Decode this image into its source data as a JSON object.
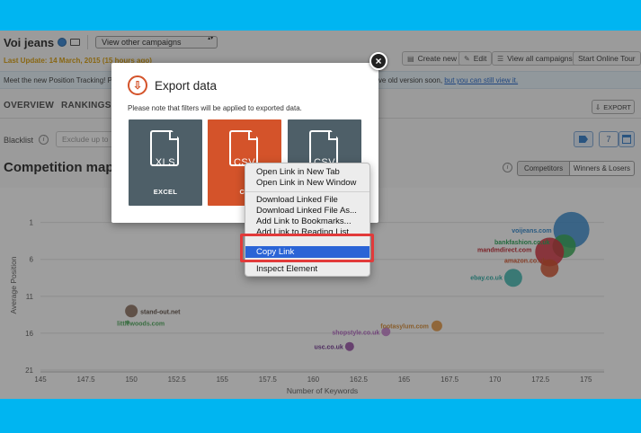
{
  "header": {
    "campaign_title": "Voi jeans",
    "campaign_select": "View other campaigns",
    "last_update": "Last Update: 14 March, 2015 (15 hours ago)"
  },
  "toolbar": {
    "create_new": "Create new",
    "edit": "Edit",
    "view_all": "View all campaigns",
    "start_tour": "Start Online Tour"
  },
  "notice": {
    "left_text": "Meet the new Position Tracking! Pl",
    "right_text": "nove old version soon,",
    "link_text": "but you can still view it."
  },
  "tabs": [
    "OVERVIEW",
    "RANKINGS"
  ],
  "export_button": "EXPORT",
  "blacklist": {
    "label": "Blacklist",
    "placeholder": "Exclude up to"
  },
  "filter_count": "7",
  "competition_map": {
    "title": "Competition map",
    "toggle_competitors": "Competitors",
    "toggle_winners": "Winners & Losers"
  },
  "chart_data": {
    "type": "scatter",
    "xlabel": "Number of Keywords",
    "ylabel": "Average Position",
    "xlim": [
      145,
      176
    ],
    "ylim": [
      21,
      -2
    ],
    "x_ticks": [
      "145",
      "147.5",
      "150",
      "152.5",
      "155",
      "157.5",
      "160",
      "162.5",
      "165",
      "167.5",
      "170",
      "172.5",
      "175"
    ],
    "y_ticks": [
      "1",
      "6",
      "11",
      "16",
      "21"
    ],
    "series": [
      {
        "name": "voijeans.com",
        "x": 174.2,
        "y": 2.0,
        "size": 20,
        "color": "#2a84cc",
        "label_color": "#2a84cc"
      },
      {
        "name": "bankfashion.co.uk",
        "x": 173.8,
        "y": 4.2,
        "size": 13,
        "color": "#2aa84a",
        "label_color": "#22a050"
      },
      {
        "name": "mandmdirect.com",
        "x": 173.0,
        "y": 5.0,
        "size": 16,
        "color": "#d0202e",
        "label_color": "#c0202a"
      },
      {
        "name": "amazon.co.uk",
        "x": 173.0,
        "y": 7.2,
        "size": 10,
        "color": "#d0451e",
        "label_color": "#d04a20"
      },
      {
        "name": "ebay.co.uk",
        "x": 171.0,
        "y": 8.5,
        "size": 10,
        "color": "#2ab0a8",
        "label_color": "#22a8a0"
      },
      {
        "name": "stand-out.net",
        "x": 150.0,
        "y": 13.0,
        "size": 7,
        "color": "#7a5a48",
        "label_color": "#5a4a40"
      },
      {
        "name": "littlewoods.com",
        "x": 149.8,
        "y": 14.5,
        "size": 2,
        "color": "#4aa858",
        "label_color": "#4aa858"
      },
      {
        "name": "footasylum.com",
        "x": 166.8,
        "y": 15.0,
        "size": 6,
        "color": "#e08a2a",
        "label_color": "#d88a30"
      },
      {
        "name": "shopstyle.co.uk",
        "x": 164.0,
        "y": 15.8,
        "size": 5,
        "color": "#c070c8",
        "label_color": "#b060c0"
      },
      {
        "name": "usc.co.uk",
        "x": 162.0,
        "y": 17.8,
        "size": 5,
        "color": "#8a3a9a",
        "label_color": "#6a2a8a"
      }
    ]
  },
  "export_modal": {
    "title": "Export data",
    "note": "Please note that filters will be applied to exported data.",
    "cards": [
      {
        "ext": "XLS",
        "label": "EXCEL",
        "color": "#4e5f68"
      },
      {
        "ext": "CSV",
        "label": "CS",
        "color": "#d4532a"
      },
      {
        "ext": "CSV",
        "label": "",
        "color": "#4e5f68"
      }
    ]
  },
  "context_menu": {
    "items": [
      "Open Link in New Tab",
      "Open Link in New Window",
      "Download Linked File",
      "Download Linked File As...",
      "Add Link to Bookmarks...",
      "Add Link to Reading List",
      "Copy Link",
      "Inspect Element"
    ],
    "highlighted": "Copy Link"
  }
}
